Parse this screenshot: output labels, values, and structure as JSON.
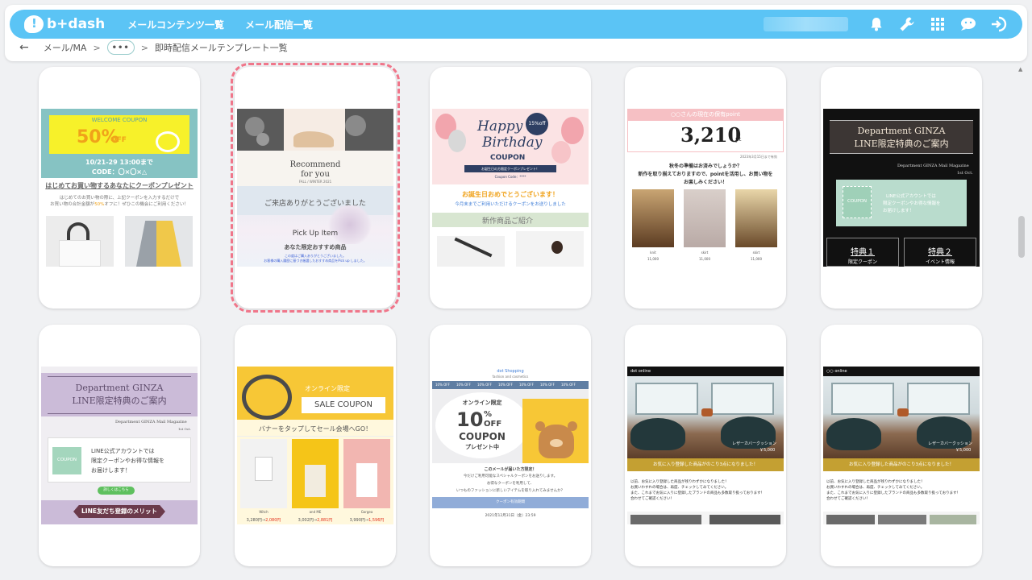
{
  "app": {
    "logo_text": "b+dash"
  },
  "nav": {
    "items": [
      "メールコンテンツ一覧",
      "メール配信一覧"
    ]
  },
  "header_icons": [
    "bell-icon",
    "wrench-icon",
    "grid-icon",
    "chat-icon",
    "logout-icon"
  ],
  "breadcrumb": {
    "back": "←",
    "root": "メール/MA",
    "sep": ">",
    "dots": "•••",
    "current": "即時配信メールテンプレート一覧"
  },
  "colors": {
    "brand": "#5bc4f5",
    "selected": "#f0768a"
  },
  "templates": [
    {
      "banner_title": "WELCOME COUPON",
      "discount": "50%",
      "discount_suffix": "OFF",
      "period": "10/21-29 13:00まで",
      "code": "CODE：〇×〇×△",
      "headline": "はじめてお買い物するあなたにクーポンプレゼント",
      "body1": "はじめてのお買い物の際に、上記クーポンを入力するだけで",
      "body2_a": "お買い物の合計金額が",
      "body2_b": "50%",
      "body2_c": "オフに！ぜひこの機会にご利用ください！"
    },
    {
      "hero_line1": "Recommend",
      "hero_line2": "for you",
      "hero_line3": "FALL / WINTER 2021",
      "thanks": "ご来店ありがとうございました",
      "pickup": "Pick Up Item",
      "sub": "あなた限定おすすめ商品",
      "note1": "この度はご購入ありがとうございました。",
      "note2": "お客様の購入履歴に基づき厳選したおすすめ商品をPick up しました。"
    },
    {
      "happy": "Happy",
      "birthday": "Birthday",
      "coupon": "COUPON",
      "badge": "15%off",
      "ribbon": "お誕生日の方限定クーポンプレゼント！",
      "code": "Coupon Code：****",
      "greet": "お誕生日おめでとうございます！",
      "greet_sub": "今月末までご利用いただけるクーポンをお送りしました",
      "section": "新作商品ご紹介"
    },
    {
      "points_title": "○○さんの現在の保有point",
      "points": "3,210",
      "points_unit": "pt",
      "asof": "2023年3月15日まで有効",
      "msg1": "秋冬の準備はお済みでしょうか？",
      "msg2": "新作を取り揃えておりますので、pointを活用し、お買い物を",
      "msg3": "お楽しみください！",
      "items": [
        {
          "name": "knit",
          "price": "11,000"
        },
        {
          "name": "skirt",
          "price": "11,000"
        },
        {
          "name": "skirt",
          "price": "11,000"
        }
      ]
    },
    {
      "title1": "Department GINZA",
      "title2": "LINE限定特典のご案内",
      "sub": "Department GINZA Mail Magazine",
      "date": "1st Oct.",
      "coupon": "COUPON",
      "line1": "LINE公式アカウントでは",
      "line2": "限定クーポンやお得な情報を",
      "line3": "お届けします！",
      "perk1": "特典１",
      "perk1_sub": "限定クーポン",
      "perk2": "特典２",
      "perk2_sub": "イベント情報"
    },
    {
      "title1": "Department GINZA",
      "title2": "LINE限定特典のご案内",
      "sub": "Department GINZA Mail Magazine",
      "date": "1st Oct.",
      "coupon": "COUPON",
      "line1": "LINE公式アカウントでは",
      "line2": "限定クーポンやお得な情報を",
      "line3": "お届けします！",
      "button": "詳しくはこちら",
      "merit": "LINE友だち登録のメリット"
    },
    {
      "online": "オンライン限定",
      "sale": "SALE COUPON",
      "tap": "バナーをタップしてセール会場へGO！",
      "items": [
        {
          "name": "Witch",
          "old": "3,280円→",
          "new": "2,080円"
        },
        {
          "name": "and ME",
          "old": "3,002円→",
          "new": "2,881円"
        },
        {
          "name": "Gorgea",
          "old": "3,990円→",
          "new": "1,596円"
        }
      ]
    },
    {
      "shop": "dot Shopping",
      "shop_sub": "fashion and cosmetics",
      "ticker": "10% OFF",
      "online": "オンライン限定",
      "pct": "10",
      "pct_sign": "%",
      "off": "OFF",
      "coupon": "COUPON",
      "gift": "プレゼント中",
      "msg1": "このメールが届いた方限定！",
      "msg2": "今だけご利用可能なスペシャルクーポンをお送りします。",
      "msg3": "お得なクーポンを利用して、",
      "msg4": "いつものファッションに新しいアイテムを取り入れてみませんか？",
      "button": "クーポン有効期間",
      "date": "2021年12月31日（金）23:59"
    },
    {
      "brand": "dot online",
      "caption": "レザーカバークッション",
      "price": "￥5,000",
      "bar": "お気に入り登録した商品がのこり3点になりました！",
      "l1": "以前、お気に入り登録した商品が残りわずかになりました！",
      "l2": "お買いわすれの場合は、再度、チェックしてみてください。",
      "l3": "また、これまでお気に入りに登録したブランドの商品も多数取り扱っております！",
      "l4": "合わせてご確認ください！"
    },
    {
      "brand": "○○ online",
      "caption": "レザーカバークッション",
      "price": "￥5,000",
      "bar": "お気に入り登録した商品がのこり3点になりました！",
      "l1": "以前、お気に入り登録した商品が残りわずかになりました！",
      "l2": "お買いわすれの場合は、再度、チェックしてみてください。",
      "l3": "また、これまでお気に入りに登録したブランドの商品も多数取り扱っております！",
      "l4": "合わせてご確認ください！"
    }
  ]
}
